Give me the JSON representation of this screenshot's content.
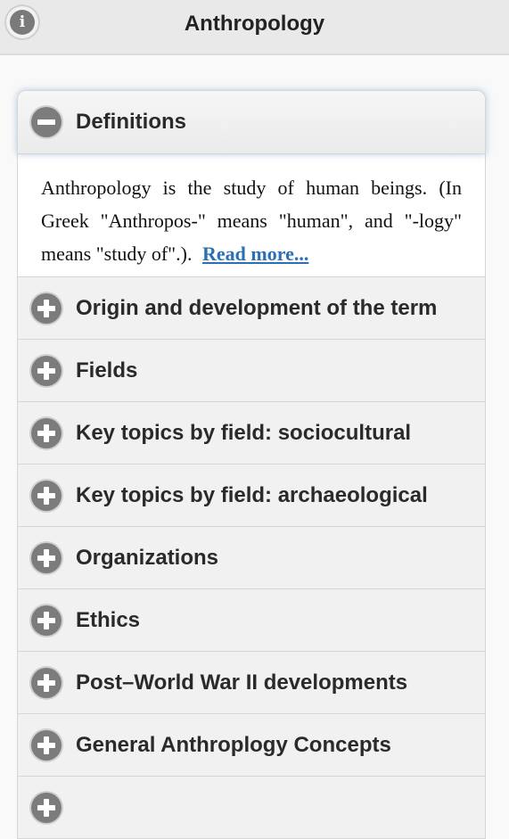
{
  "header": {
    "title": "Anthropology",
    "info_icon": "info-icon"
  },
  "expanded_section": {
    "label": "Definitions",
    "body": "Anthropology is the study of human beings. (In Greek \"Anthropos-\" means \"human\", and \"-logy\" means \"study of\".).",
    "read_more": "Read more..."
  },
  "sections": [
    {
      "label": "Origin and development of the term"
    },
    {
      "label": "Fields"
    },
    {
      "label": "Key topics by field: sociocultural"
    },
    {
      "label": "Key topics by field: archaeological"
    },
    {
      "label": "Organizations"
    },
    {
      "label": "Ethics"
    },
    {
      "label": "Post–World War II developments"
    },
    {
      "label": "General Anthroplogy Concepts"
    }
  ],
  "colors": {
    "link": "#2b6fb6",
    "icon": "#7c7c7c",
    "header_bg": "#e9e9e9"
  }
}
